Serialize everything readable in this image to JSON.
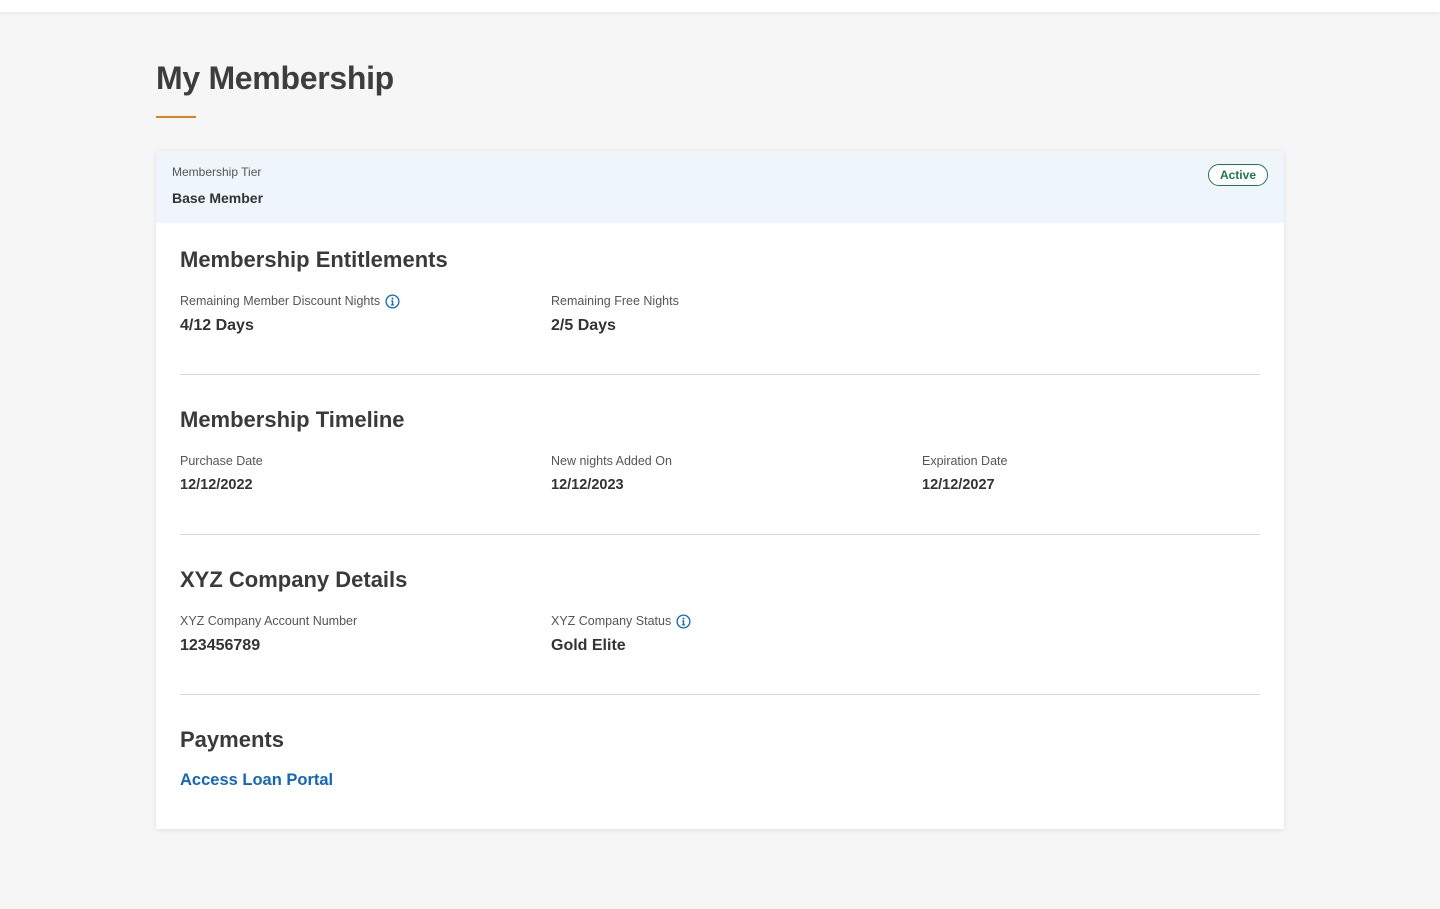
{
  "page": {
    "title": "My Membership"
  },
  "tier": {
    "label": "Membership Tier",
    "value": "Base Member",
    "status": "Active"
  },
  "entitlements": {
    "title": "Membership Entitlements",
    "discount_nights_label": "Remaining Member Discount Nights",
    "discount_nights_value": "4/12 Days",
    "free_nights_label": "Remaining Free Nights",
    "free_nights_value": "2/5 Days"
  },
  "timeline": {
    "title": "Membership Timeline",
    "purchase_label": "Purchase Date",
    "purchase_value": "12/12/2022",
    "new_nights_label": "New nights Added On",
    "new_nights_value": "12/12/2023",
    "expiration_label": "Expiration Date",
    "expiration_value": "12/12/2027"
  },
  "company": {
    "title": "XYZ Company Details",
    "account_label": "XYZ Company Account Number",
    "account_value": "123456789",
    "status_label": "XYZ Company Status",
    "status_value": "Gold Elite"
  },
  "payments": {
    "title": "Payments",
    "loan_link": "Access Loan Portal"
  },
  "icons": {
    "info": "info-circle-icon"
  },
  "colors": {
    "accent_underline": "#d9841f",
    "active_badge": "#1b7a4a",
    "link": "#1166c1",
    "info_icon": "#1166c1",
    "tier_header_bg": "#eef6fc"
  }
}
